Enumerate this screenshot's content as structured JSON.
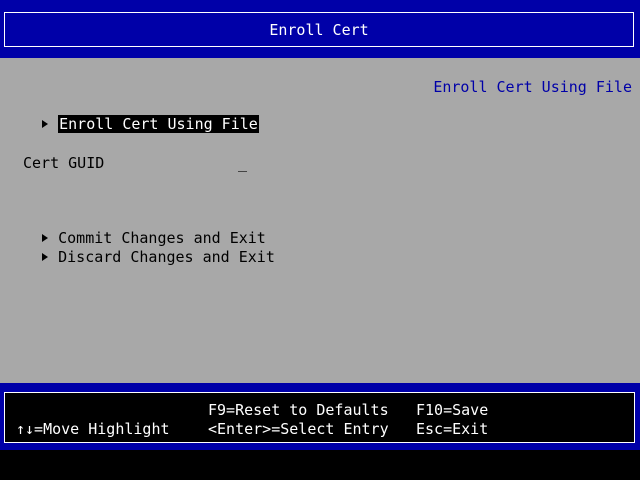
{
  "title": "Enroll Cert",
  "help_text": "Enroll Cert Using File",
  "menu": {
    "enroll_file": "Enroll Cert Using File",
    "cert_guid_label": "Cert GUID",
    "cert_guid_value": "_",
    "commit": "Commit Changes and Exit",
    "discard": "Discard Changes and Exit"
  },
  "footer": {
    "move_highlight": "↑↓=Move Highlight",
    "reset_defaults": "F9=Reset to Defaults",
    "select_entry": "<Enter>=Select Entry",
    "save": "F10=Save",
    "exit": "Esc=Exit"
  },
  "colors": {
    "title_bg": "#0000a8",
    "content_bg": "#a8a8a8",
    "help_text": "#0000a8",
    "highlight_bg": "#000000",
    "highlight_fg": "#ffffff"
  },
  "icons": {
    "submenu": "right-triangle-icon"
  }
}
